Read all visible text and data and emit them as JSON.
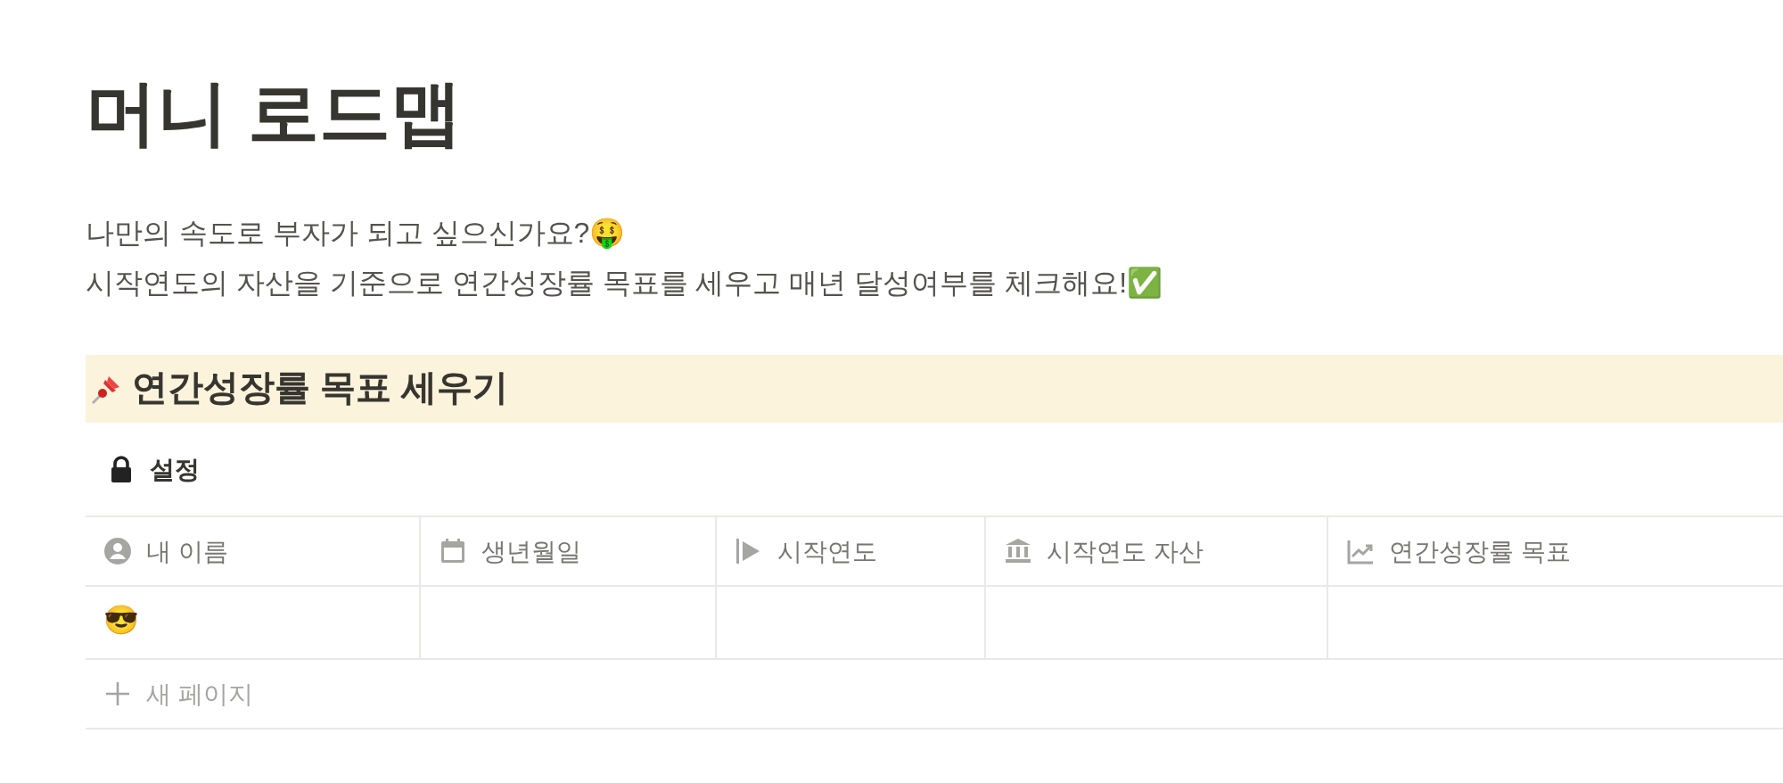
{
  "page": {
    "title": "머니 로드맵",
    "description": [
      "나만의 속도로 부자가 되고 싶으신가요?🤑",
      "시작연도의 자산을 기준으로 연간성장률 목표를 세우고 매년 달성여부를 체크해요!✅"
    ]
  },
  "section": {
    "heading": "연간성장률 목표 세우기",
    "view_tab": "설정",
    "table": {
      "columns": [
        {
          "label": "내 이름",
          "kind": "person"
        },
        {
          "label": "생년월일",
          "kind": "date"
        },
        {
          "label": "시작연도",
          "kind": "select"
        },
        {
          "label": "시작연도 자산",
          "kind": "money"
        },
        {
          "label": "연간성장률 목표",
          "kind": "growth"
        }
      ],
      "rows": [
        [
          "😎",
          "",
          "",
          "",
          ""
        ]
      ],
      "new_row": "새 페이지"
    }
  }
}
